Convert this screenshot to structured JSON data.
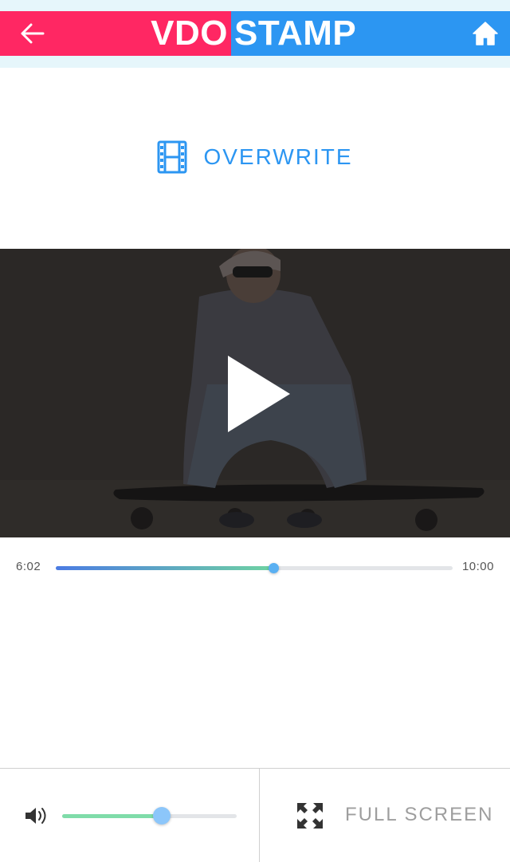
{
  "header": {
    "logo_left": "VDO",
    "logo_right": "STAMP",
    "colors": {
      "left": "#ff2763",
      "right": "#2c96f2"
    },
    "back_icon": "arrow-left-icon",
    "home_icon": "home-icon"
  },
  "mode": {
    "label": "OVERWRITE",
    "icon": "film-strip-icon"
  },
  "player": {
    "play_icon": "play-icon",
    "current_time": "6:02",
    "total_time": "10:00",
    "progress_fraction": 0.55
  },
  "controls": {
    "volume_icon": "volume-icon",
    "volume_fraction": 0.57,
    "fullscreen_label": "FULL SCREEN",
    "fullscreen_icon": "fullscreen-icon"
  }
}
